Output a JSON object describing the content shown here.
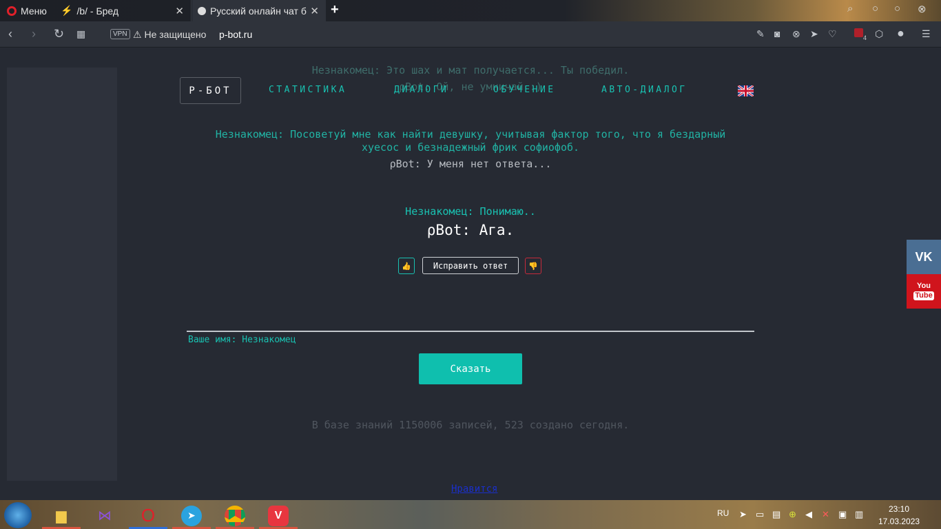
{
  "browser": {
    "menu_label": "Меню",
    "tabs": [
      {
        "title": "/b/ - Бред"
      },
      {
        "title": "Русский онлайн чат бот"
      }
    ],
    "security_label": "Не защищено",
    "url": "p-bot.ru",
    "vpn_label": "VPN",
    "extension_badge": "4"
  },
  "nav": {
    "logo": "Р-БОТ",
    "links": [
      "СТАТИСТИКА",
      "ДИАЛОГИ",
      "ОБУЧЕНИЕ",
      "АВТО-ДИАЛОГ"
    ]
  },
  "chat": {
    "faded_user": "Незнакомец: Это шах и мат получается... Ты победил.",
    "faded_bot": "ρBot: Ой, не умничай :)",
    "prev_user": "Незнакомец: Посоветуй мне как найти девушку, учитывая фактор того, что я бездарный",
    "prev_user_line2": "хуесос и безнадежный фрик софиофоб.",
    "prev_bot": "ρBot: У меня нет ответа...",
    "cur_user": "Незнакомец: Понимаю..",
    "cur_bot": "ρBot: Ага."
  },
  "actions": {
    "fix_answer": "Исправить ответ",
    "name_row": "Ваше имя: Незнакомец",
    "say_button": "Сказать"
  },
  "stats": "В базе знаний 1150006 записей, 523 создано сегодня.",
  "like_link": "Нравится",
  "social": {
    "vk": "VK",
    "yt_line1": "You",
    "yt_line2": "Tube"
  },
  "taskbar": {
    "lang": "RU",
    "time": "23:10",
    "date": "17.03.2023"
  },
  "colors": {
    "accent": "#19c2b2",
    "say_button": "#0fbfae",
    "thumb_down": "#d22c3e"
  }
}
